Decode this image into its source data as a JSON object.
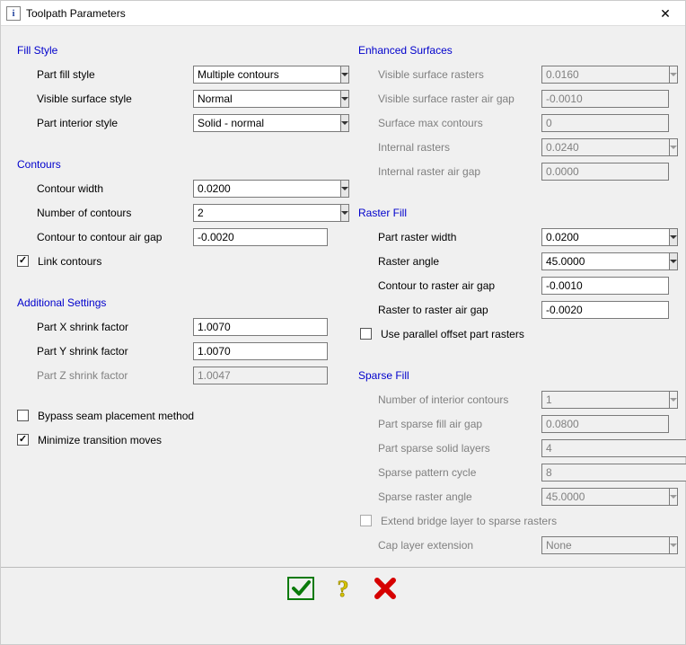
{
  "window": {
    "title": "Toolpath Parameters"
  },
  "fill_style": {
    "title": "Fill Style",
    "part_fill_style": {
      "label": "Part fill style",
      "value": "Multiple contours"
    },
    "visible_surface_style": {
      "label": "Visible surface style",
      "value": "Normal"
    },
    "part_interior_style": {
      "label": "Part interior style",
      "value": "Solid - normal"
    }
  },
  "contours": {
    "title": "Contours",
    "contour_width": {
      "label": "Contour width",
      "value": "0.0200"
    },
    "number_of_contours": {
      "label": "Number of contours",
      "value": "2"
    },
    "contour_air_gap": {
      "label": "Contour to contour air gap",
      "value": "-0.0020"
    },
    "link_contours": {
      "label": "Link contours",
      "checked": true
    }
  },
  "additional": {
    "title": "Additional Settings",
    "part_x": {
      "label": "Part X shrink factor",
      "value": "1.0070"
    },
    "part_y": {
      "label": "Part Y shrink factor",
      "value": "1.0070"
    },
    "part_z": {
      "label": "Part Z shrink factor",
      "value": "1.0047"
    },
    "bypass_seam": {
      "label": "Bypass seam placement method",
      "checked": false
    },
    "minimize_trans": {
      "label": "Minimize transition moves",
      "checked": true
    }
  },
  "enhanced": {
    "title": "Enhanced Surfaces",
    "vis_rasters": {
      "label": "Visible surface rasters",
      "value": "0.0160"
    },
    "vis_air_gap": {
      "label": "Visible surface raster air gap",
      "value": "-0.0010"
    },
    "max_contours": {
      "label": "Surface max contours",
      "value": "0"
    },
    "internal_rasters": {
      "label": "Internal rasters",
      "value": "0.0240"
    },
    "internal_air_gap": {
      "label": "Internal raster air gap",
      "value": "0.0000"
    }
  },
  "raster": {
    "title": "Raster Fill",
    "width": {
      "label": "Part raster width",
      "value": "0.0200"
    },
    "angle": {
      "label": "Raster angle",
      "value": "45.0000"
    },
    "contour_raster_gap": {
      "label": "Contour to raster air gap",
      "value": "-0.0010"
    },
    "raster_raster_gap": {
      "label": "Raster to raster air gap",
      "value": "-0.0020"
    },
    "parallel_offset": {
      "label": "Use parallel offset part rasters",
      "checked": false
    }
  },
  "sparse": {
    "title": "Sparse Fill",
    "interior_contours": {
      "label": "Number of interior contours",
      "value": "1"
    },
    "air_gap": {
      "label": "Part sparse fill air gap",
      "value": "0.0800"
    },
    "solid_layers": {
      "label": "Part sparse solid layers",
      "value": "4"
    },
    "pattern_cycle": {
      "label": "Sparse pattern cycle",
      "value": "8"
    },
    "raster_angle": {
      "label": "Sparse raster angle",
      "value": "45.0000"
    },
    "extend_bridge": {
      "label": "Extend bridge layer to sparse rasters",
      "checked": false
    },
    "cap_ext": {
      "label": "Cap layer extension",
      "value": "None"
    }
  }
}
